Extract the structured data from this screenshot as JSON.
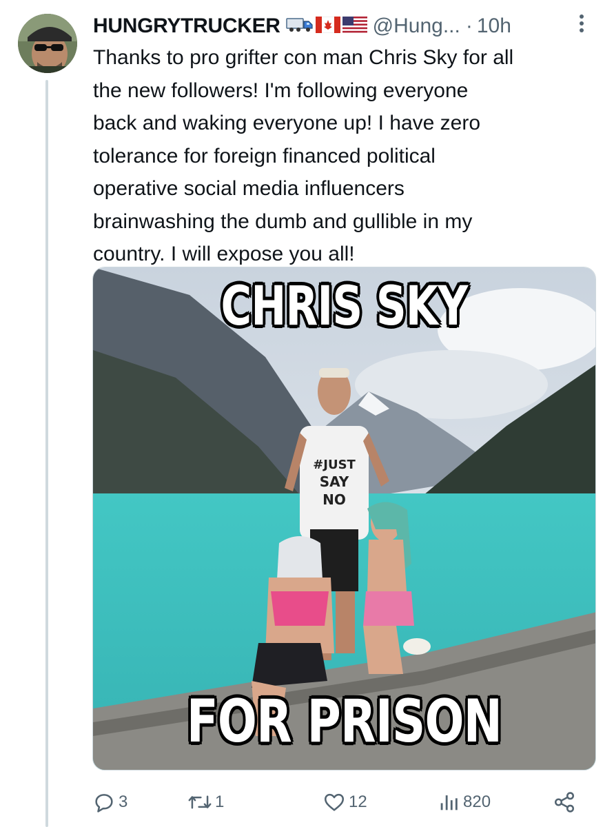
{
  "user": {
    "display_name": "HUNGRYTRUCKER",
    "badges": [
      "truck-emoji",
      "canada-flag-emoji",
      "usa-flag-emoji"
    ],
    "handle": "@Hung...",
    "separator": "·",
    "time": "10h"
  },
  "tweet": {
    "text": "Thanks to pro grifter con man Chris Sky for all\nthe new followers! I'm following everyone\nback and waking everyone up! I have zero\ntolerance for foreign financed political\noperative social media influencers\nbrainwashing the dumb and gullible in my\ncountry. I will expose you all!"
  },
  "media": {
    "top_caption": "CHRIS SKY",
    "bottom_caption": "FOR PRISON",
    "shirt_text": [
      "#JUST",
      "SAY",
      "NO"
    ]
  },
  "actions": {
    "replies": "3",
    "reposts": "1",
    "likes": "12",
    "views": "820"
  },
  "colors": {
    "text_primary": "#0f1419",
    "text_secondary": "#536471",
    "thread_line": "#cfd9de",
    "lake": "#3fc3c0"
  }
}
